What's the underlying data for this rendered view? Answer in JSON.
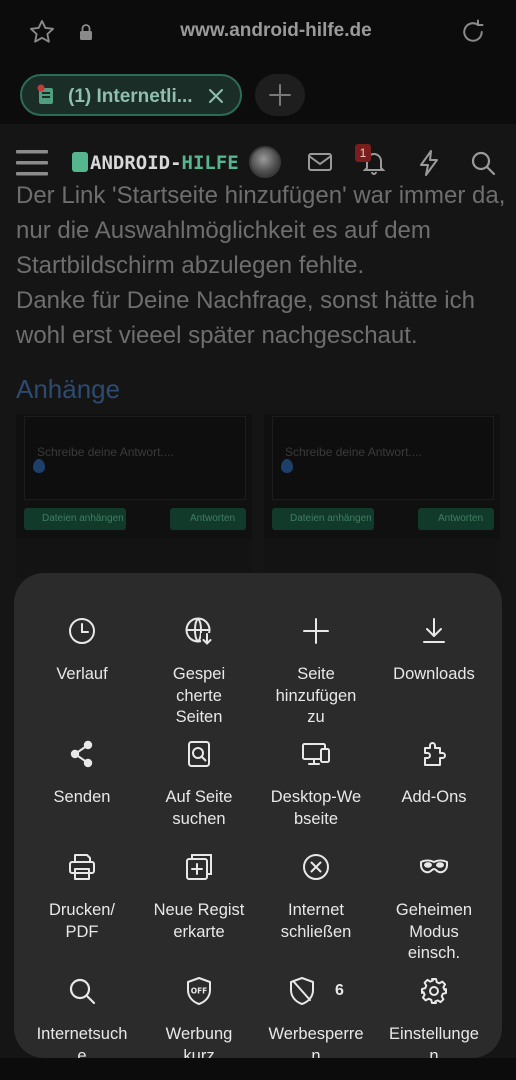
{
  "browser": {
    "url": "www.android-hilfe.de",
    "tab_title": "(1) Internetli..."
  },
  "site": {
    "logo_part1": "ANDROID-",
    "logo_part2": "HILFE",
    "notification_count": "1",
    "post_lines": [
      "Der Link 'Startseite hinzufügen' war immer da,",
      "nur die Auswahlmöglichkeit es auf dem",
      "Startbildschirm abzulegen fehlte.",
      "Danke für Deine Nachfrage, sonst hätte ich",
      "wohl erst vieeel später nachgeschaut."
    ],
    "attachments_heading": "Anhänge",
    "thumb_placeholder": "Schreibe deine Antwort....",
    "thumb_attach_btn": "Dateien anhängen",
    "thumb_reply_btn": "Antworten"
  },
  "menu": {
    "items": [
      {
        "name": "history",
        "icon": "clock-icon",
        "lines": [
          "Verlauf"
        ]
      },
      {
        "name": "saved-pages",
        "icon": "globe-download-icon",
        "lines": [
          "Gespei",
          "cherte",
          "Seiten"
        ]
      },
      {
        "name": "add-page",
        "icon": "plus-icon",
        "lines": [
          "Seite",
          "hinzufügen",
          "zu"
        ]
      },
      {
        "name": "downloads",
        "icon": "download-icon",
        "lines": [
          "Downloads"
        ]
      },
      {
        "name": "share",
        "icon": "share-icon",
        "lines": [
          "Senden"
        ]
      },
      {
        "name": "find-on-page",
        "icon": "find-page-icon",
        "lines": [
          "Auf Seite",
          "suchen"
        ]
      },
      {
        "name": "desktop-site",
        "icon": "desktop-icon",
        "lines": [
          "Desktop-We",
          "bseite"
        ]
      },
      {
        "name": "add-ons",
        "icon": "puzzle-icon",
        "lines": [
          "Add-Ons"
        ]
      },
      {
        "name": "print-pdf",
        "icon": "printer-icon",
        "lines": [
          "Drucken/",
          "PDF"
        ]
      },
      {
        "name": "new-tab",
        "icon": "new-tab-icon",
        "lines": [
          "Neue Regist",
          "erkarte"
        ]
      },
      {
        "name": "close-internet",
        "icon": "close-circle-icon",
        "lines": [
          "Internet",
          "schließen"
        ]
      },
      {
        "name": "secret-mode",
        "icon": "mask-icon",
        "lines": [
          "Geheimen",
          "Modus",
          "einsch."
        ]
      },
      {
        "name": "web-search",
        "icon": "search-icon",
        "lines": [
          "Internetsuch",
          "e"
        ]
      },
      {
        "name": "ad-block-short",
        "icon": "ad-off-icon",
        "lines": [
          "Werbung",
          "kurz"
        ]
      },
      {
        "name": "ad-blocker",
        "icon": "shield-icon",
        "lines": [
          "Werbesperre",
          "n"
        ],
        "badge": "6"
      },
      {
        "name": "settings",
        "icon": "gear-icon",
        "lines": [
          "Einstellunge",
          "n"
        ]
      }
    ]
  },
  "colors": {
    "sheet_bg": "#2b2b2b",
    "accent_green": "#55b58f",
    "link_blue": "#2d4a70"
  }
}
